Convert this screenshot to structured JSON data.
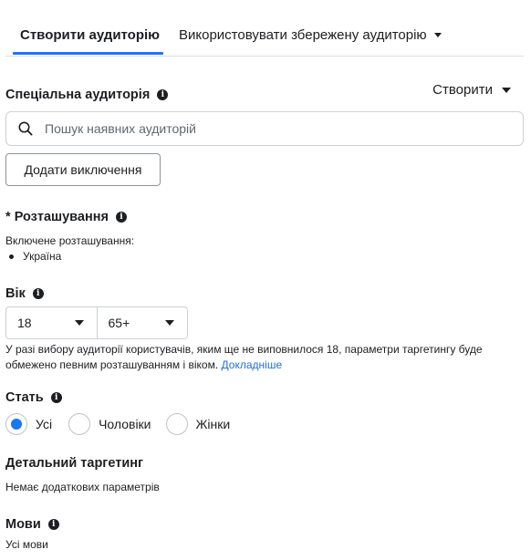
{
  "tabs": {
    "create": "Створити аудиторію",
    "saved": "Використовувати збережену аудиторію"
  },
  "custom_audience": {
    "title": "Спеціальна аудиторія",
    "create_label": "Створити",
    "search_placeholder": "Пошук наявних аудиторій",
    "add_exclusions": "Додати виключення"
  },
  "location": {
    "required_mark": "*",
    "title": "Розташування",
    "included_label": "Включене розташування:",
    "items": [
      "Україна"
    ]
  },
  "age": {
    "title": "Вік",
    "min": "18",
    "max": "65+",
    "notice": "У разі вибору аудиторії користувачів, яким ще не виповнилося 18, параметри таргетингу буде обмежено певним розташуванням і віком.",
    "learn_more": "Докладніше"
  },
  "gender": {
    "title": "Стать",
    "options": [
      "Усі",
      "Чоловіки",
      "Жінки"
    ],
    "selected": "Усі"
  },
  "detailed_targeting": {
    "title": "Детальний таргетинг",
    "value": "Немає додаткових параметрів"
  },
  "languages": {
    "title": "Мови",
    "value": "Усі мови"
  },
  "colors": {
    "accent": "#1877f2",
    "link": "#216fdb",
    "border": "#ccd0d5"
  },
  "icons": {
    "info": "info-icon",
    "search": "search-icon",
    "dropdown": "caret-down-icon"
  }
}
